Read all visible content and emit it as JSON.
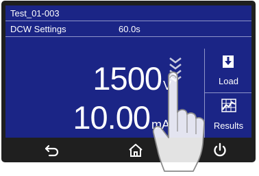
{
  "header": {
    "test_name": "Test_01-003",
    "settings_label": "DCW Settings",
    "duration": "60.0s"
  },
  "readings": {
    "voltage_value": "1500",
    "voltage_unit": "V",
    "current_value": "10.00",
    "current_unit": "mA"
  },
  "side_buttons": {
    "load_label": "Load",
    "results_label": "Results"
  },
  "nav": {
    "back_icon": "back-arrow-icon",
    "home_icon": "home-icon",
    "power_icon": "power-icon"
  },
  "colors": {
    "screen_bg": "#1b2586",
    "bezel": "#1f1f1f",
    "text": "#ffffff"
  }
}
